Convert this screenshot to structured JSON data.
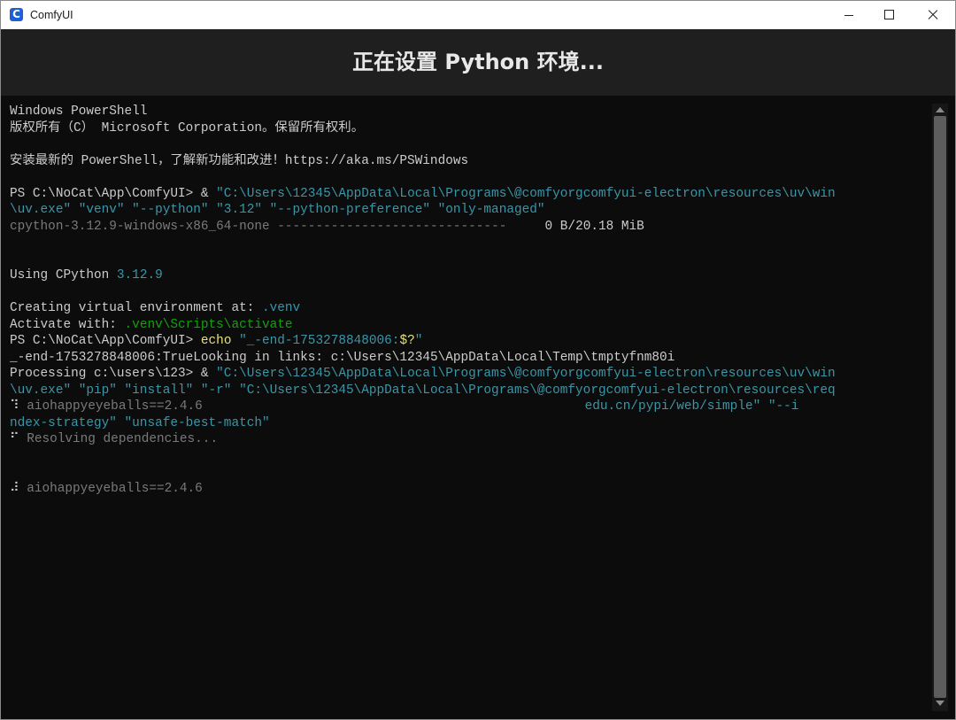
{
  "window": {
    "app_title": "ComfyUI",
    "app_icon_glyph": "C",
    "icons": [
      "comfyui-app-icon",
      "minimize-icon",
      "maximize-icon",
      "close-icon"
    ]
  },
  "header": {
    "title": "正在设置 Python 环境..."
  },
  "terminal": {
    "lines": [
      [
        {
          "t": "Windows PowerShell",
          "c": "white"
        }
      ],
      [
        {
          "t": "版权所有（C） Microsoft Corporation。保留所有权利。",
          "c": "white"
        }
      ],
      [],
      [
        {
          "t": "安装最新的 PowerShell，了解新功能和改进！https://aka.ms/PSWindows",
          "c": "white"
        }
      ],
      [],
      [
        {
          "t": "PS C:\\NoCat\\App\\ComfyUI> & ",
          "c": "white"
        },
        {
          "t": "\"C:\\Users\\12345\\AppData\\Local\\Programs\\@comfyorgcomfyui-electron\\resources\\uv\\win",
          "c": "cyan"
        }
      ],
      [
        {
          "t": "\\uv.exe\" \"venv\" \"--python\" \"3.12\" \"--python-preference\" \"only-managed\"",
          "c": "cyan"
        }
      ],
      [
        {
          "t": "cpython-3.12.9-windows-x86_64-none ",
          "c": "gray"
        },
        {
          "t": "------------------------------",
          "c": "gray"
        },
        {
          "t": "     0 B/20.18 MiB",
          "c": "white"
        }
      ],
      [],
      [],
      [
        {
          "t": "Using CPython ",
          "c": "white"
        },
        {
          "t": "3.12.9",
          "c": "cyan"
        }
      ],
      [],
      [
        {
          "t": "Creating virtual environment at: ",
          "c": "white"
        },
        {
          "t": ".venv",
          "c": "cyan"
        }
      ],
      [
        {
          "t": "Activate with: ",
          "c": "white"
        },
        {
          "t": ".venv\\Scripts\\activate",
          "c": "green"
        }
      ],
      [
        {
          "t": "PS C:\\NoCat\\App\\ComfyUI> ",
          "c": "white"
        },
        {
          "t": "echo",
          "c": "yellow"
        },
        {
          "t": " \"_-end-1753278848006:",
          "c": "cyan"
        },
        {
          "t": "$?",
          "c": "yellow"
        },
        {
          "t": "\"",
          "c": "cyan"
        }
      ],
      [
        {
          "t": "_-end-1753278848006:TrueLooking in links: c:\\Users\\12345\\AppData\\Local\\Temp\\tmptyfnm80i",
          "c": "white"
        }
      ],
      [
        {
          "t": "Processing c:\\users\\123> & ",
          "c": "white"
        },
        {
          "t": "\"C:\\Users\\12345\\AppData\\Local\\Programs\\@comfyorgcomfyui-electron\\resources\\uv\\win",
          "c": "cyan"
        }
      ],
      [
        {
          "t": "\\uv.exe\" \"pip\" \"install\" \"-r\" \"C:\\Users\\12345\\AppData\\Local\\Programs\\@comfyorgcomfyui-electron\\resources\\req",
          "c": "cyan"
        }
      ],
      [
        {
          "t": "⠹ ",
          "c": "white"
        },
        {
          "t": "aiohappyeyeballs==2.4.6",
          "c": "gray"
        },
        {
          "t": "                                                  edu.cn/pypi/web/simple\" \"--i",
          "c": "cyan"
        }
      ],
      [
        {
          "t": "ndex-strategy\" \"unsafe-best-match\"",
          "c": "cyan"
        }
      ],
      [
        {
          "t": "⠋ ",
          "c": "white"
        },
        {
          "t": "Resolving dependencies...",
          "c": "gray"
        }
      ],
      [],
      [],
      [
        {
          "t": "⠼ ",
          "c": "white"
        },
        {
          "t": "aiohappyeyeballs==2.4.6",
          "c": "gray"
        }
      ]
    ]
  },
  "colors": {
    "terminal_bg": "#0c0c0c",
    "header_bg": "#1f1f1f",
    "text": "#cccccc",
    "cyan": "#3a96a8",
    "gray": "#7a7a7a",
    "yellow": "#e6e27a",
    "green": "#13a10e"
  }
}
